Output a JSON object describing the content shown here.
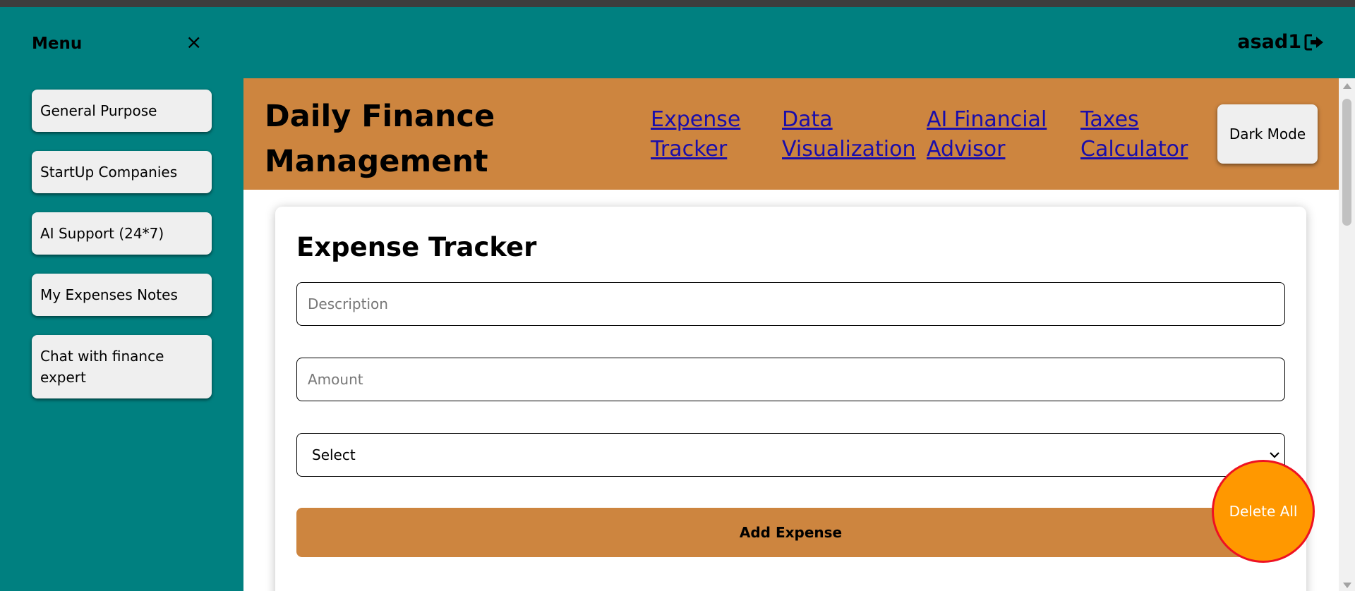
{
  "topbar": {
    "menu_title": "Menu",
    "close_icon": "×",
    "username": "asad1",
    "logout_icon": "sign-out-icon"
  },
  "sidebar": {
    "items": [
      {
        "label": "General Purpose"
      },
      {
        "label": "StartUp Companies"
      },
      {
        "label": "AI Support (24*7)"
      },
      {
        "label": "My Expenses Notes"
      },
      {
        "label": "Chat with finance expert"
      }
    ]
  },
  "header": {
    "title": "Daily Finance Management",
    "nav": [
      {
        "label": "Expense Tracker"
      },
      {
        "label": "Data Visualization"
      },
      {
        "label": "AI Financial Advisor"
      },
      {
        "label": "Taxes Calculator"
      }
    ],
    "dark_mode_label": "Dark Mode"
  },
  "expense_form": {
    "title": "Expense Tracker",
    "description_placeholder": "Description",
    "amount_placeholder": "Amount",
    "category_selected": "Select",
    "add_button_label": "Add Expense"
  },
  "delete_all_label": "Delete All",
  "colors": {
    "teal": "#008080",
    "header": "#cd853f",
    "delete_button": "#ff9800",
    "delete_border": "#ee1122",
    "link": "#1a0dab"
  }
}
